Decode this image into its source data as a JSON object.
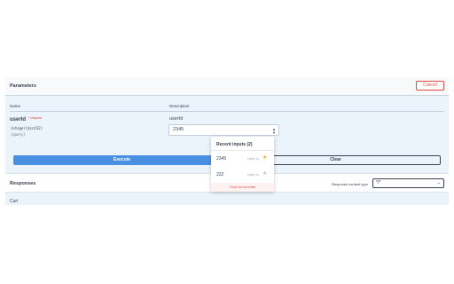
{
  "parameters": {
    "title": "Parameters",
    "cancel_label": "Cancel",
    "col_name": "Name",
    "col_description": "Description"
  },
  "param": {
    "name": "userId",
    "required_marker": "* required",
    "type": "integer($int32)",
    "location": "(query)",
    "description": "userId",
    "value": "2345"
  },
  "actions": {
    "execute_label": "Execute",
    "clear_label": "Clear"
  },
  "responses": {
    "title": "Responses",
    "content_type_label": "Response content type",
    "content_type_value": "*/*",
    "curl_label": "Curl"
  },
  "recent": {
    "title": "Recent inputs (2)",
    "items": [
      {
        "value": "2345",
        "used": "Used 1x",
        "starred": true
      },
      {
        "value": "222",
        "used": "Used 1x",
        "starred": false
      }
    ],
    "clear_label": "Clear non-favorites"
  },
  "colors": {
    "accent": "#4990e2",
    "danger": "#e04848",
    "panel_bg": "#ebf3fb",
    "star_active": "#f5a623"
  },
  "icons": {
    "spinner": "up-down-arrows-icon",
    "select": "chevron-down-icon",
    "favorite": "star-icon"
  }
}
